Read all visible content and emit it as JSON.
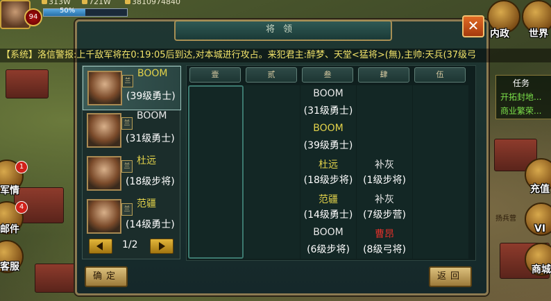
{
  "hud": {
    "level": "94",
    "resources": [
      "313W",
      "721W",
      "3810974840"
    ],
    "exp_percent": "50%",
    "exp_fraction": 0.5
  },
  "right_menu": {
    "neizheng": "内政",
    "shijie": "世界",
    "chongzhi": "充值",
    "vip": "VI",
    "shangcheng": "商城"
  },
  "left_menu": {
    "junqing": "军情",
    "junqing_badge": "1",
    "youjian": "邮件",
    "youjian_badge": "4",
    "kefu": "客服"
  },
  "quest": {
    "title": "任务",
    "items": [
      "开拓封地...",
      "商业繁荣..."
    ]
  },
  "barracks_sign": "扬兵营",
  "dialog": {
    "title": "将领",
    "close": "✕",
    "announcement": "【系统】洛信警报:上千敌军将在0:19:05后到达,对本城进行攻占。来犯君主:醉梦、天堂<猛将>(無),主帅:天兵(37级弓"
  },
  "generals": [
    {
      "name": "BOOM",
      "desc": "(39级勇士)",
      "flag": "兰",
      "name_color": "#e2d24a",
      "selected": true
    },
    {
      "name": "BOOM",
      "desc": "(31级勇士)",
      "flag": "兰",
      "name_color": "#e8e8e8",
      "selected": false
    },
    {
      "name": "杜远",
      "desc": "(18级步将)",
      "flag": "兰",
      "name_color": "#e2d24a",
      "selected": false
    },
    {
      "name": "范疆",
      "desc": "(14级勇士)",
      "flag": "兰",
      "name_color": "#e2d24a",
      "selected": false
    }
  ],
  "pager": {
    "text": "1/2"
  },
  "columns": [
    "壹",
    "贰",
    "叁",
    "肆",
    "伍"
  ],
  "formation": {
    "col3": [
      {
        "name": "BOOM",
        "desc": "(31级勇士)",
        "color": "#e8e8e8"
      },
      {
        "name": "BOOM",
        "desc": "(39级勇士)",
        "color": "#e2d24a"
      },
      {
        "name": "杜远",
        "desc": "(18级步将)",
        "color": "#e2d24a"
      },
      {
        "name": "范疆",
        "desc": "(14级勇士)",
        "color": "#e2d24a"
      },
      {
        "name": "BOOM",
        "desc": "(6级步将)",
        "color": "#e8e8e8"
      }
    ],
    "col4": [
      {
        "name": "补灰",
        "desc": "(1级步将)",
        "color": "#e8e8e8",
        "row": 2
      },
      {
        "name": "补灰",
        "desc": "(7级步营)",
        "color": "#e8e8e8",
        "row": 3
      },
      {
        "name": "曹昂",
        "desc": "(8级弓将)",
        "color": "#e0302a",
        "row": 4
      }
    ]
  },
  "buttons": {
    "confirm": "确定",
    "back": "返回"
  }
}
